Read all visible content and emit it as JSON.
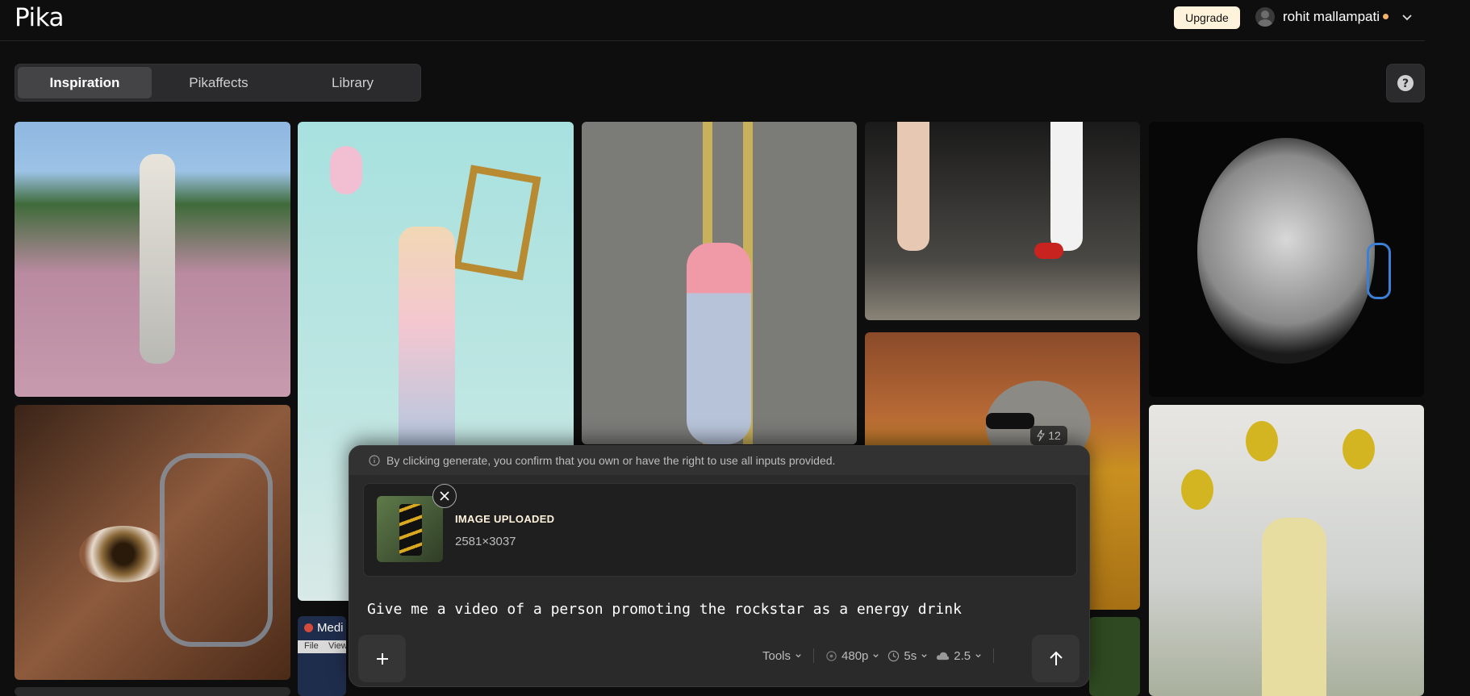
{
  "header": {
    "logo": "Pika",
    "upgrade_label": "Upgrade",
    "user_name": "rohit mallampati",
    "status_color": "#f6b26b"
  },
  "tabs": [
    {
      "label": "Inspiration",
      "active": true
    },
    {
      "label": "Pikaffects",
      "active": false
    },
    {
      "label": "Library",
      "active": false
    }
  ],
  "help_icon": "question-circle-icon",
  "gallery": {
    "credits": "12",
    "partial_window_title": "Medi",
    "partial_menu": [
      "File",
      "View"
    ]
  },
  "composer": {
    "notice": "By clicking generate, you confirm that you own or have the right to use all inputs provided.",
    "upload": {
      "label": "IMAGE UPLOADED",
      "dimensions": "2581×3037"
    },
    "prompt": "Give me a video of a person promoting the rockstar as a energy drink",
    "tools_label": "Tools",
    "resolution": "480p",
    "duration": "5s",
    "model": "2.5"
  }
}
